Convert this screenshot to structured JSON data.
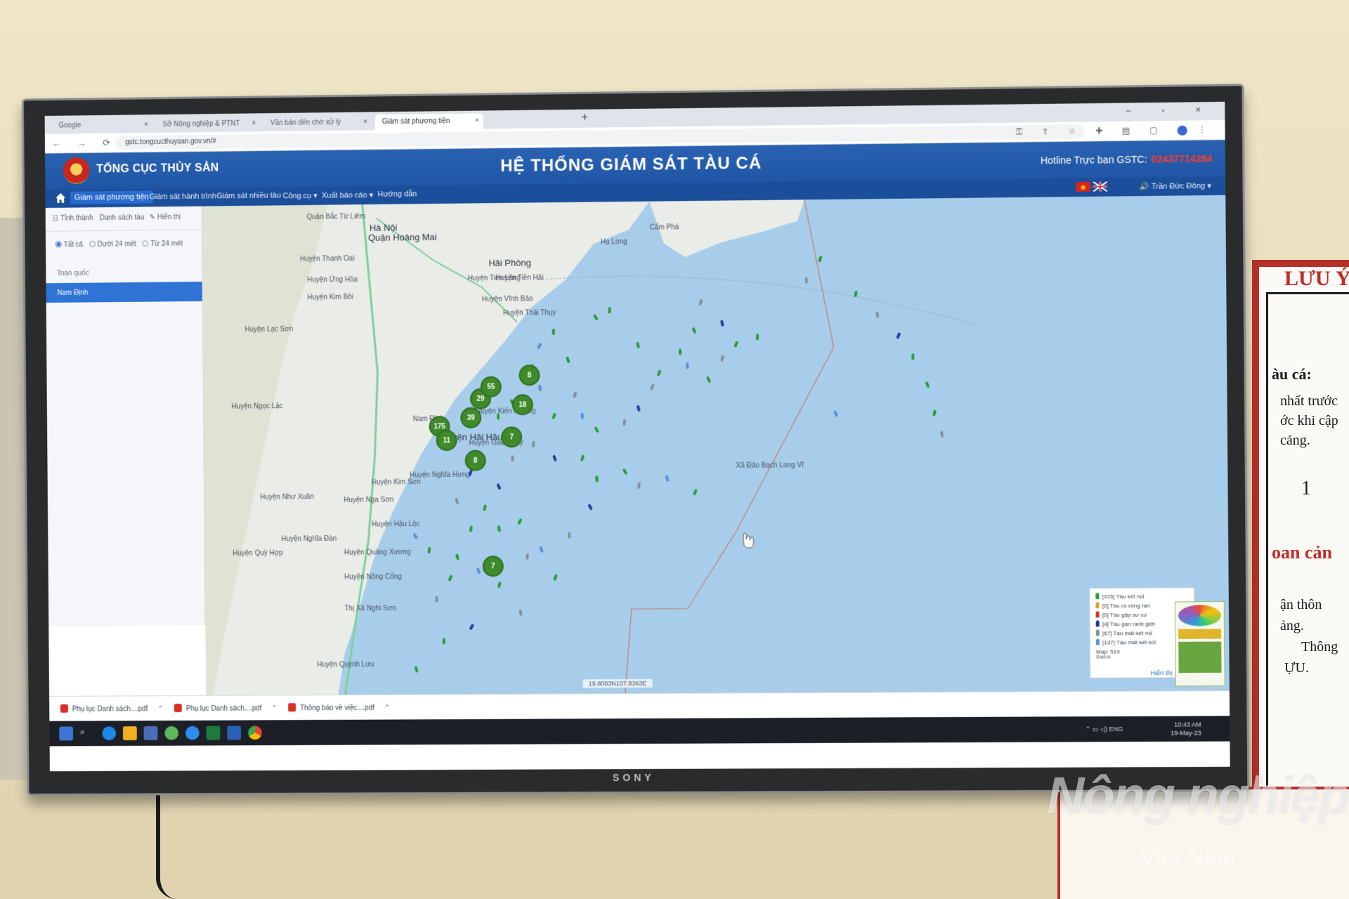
{
  "browser": {
    "tabs": [
      {
        "label": "Google"
      },
      {
        "label": "Sở Nông nghiệp & PTNT"
      },
      {
        "label": "Văn bản đến chờ xử lý"
      },
      {
        "label": "Giám sát phương tiện"
      }
    ],
    "url": "gstc.tongcucthuysan.gov.vn/#"
  },
  "header": {
    "agency": "TỔNG CỤC THỦY SẢN",
    "title": "HỆ THỐNG GIÁM SÁT TÀU CÁ",
    "hotline_label": "Hotline Trực ban GSTC:",
    "hotline_number": "02437714284"
  },
  "menu": {
    "items": [
      "Giám sát phương tiện",
      "Giám sát hành trình",
      "Giám sát nhiều tàu",
      "Công cụ ▾",
      "Xuất báo cáo ▾",
      "Hướng dẫn"
    ],
    "user": "Trần Đức Đông ▾"
  },
  "sidebar": {
    "tabs": [
      "Tỉnh thành",
      "Danh sách tàu",
      "Hiển thị"
    ],
    "filters": [
      "Tất cả",
      "Dưới 24 mét",
      "Từ 24 mét"
    ],
    "items": [
      "Toàn quốc",
      "Nam Định"
    ]
  },
  "map": {
    "places": [
      "Hà Nội",
      "Quận Hoàng Mai",
      "Hải Phòng",
      "Huyện Hải Hậu",
      "Nam Định",
      "Huyện Giao Thủy",
      "Huyện Nghĩa Hưng",
      "Huyện Kim Sơn",
      "Huyện Nga Sơn",
      "Huyện Hậu Lộc",
      "Huyện Quảng Xương",
      "Huyện Nông Cống",
      "Thị Xã Nghi Sơn",
      "Huyện Quỳnh Lưu",
      "Cẩm Phả",
      "Hạ Long",
      "Xã Đảo Bạch Long Vĩ",
      "Huyện Thái Thụy",
      "Huyện Tiền Hải",
      "Huyện Kiến Xương",
      "Huyện Vĩnh Bảo",
      "Huyện Tiên Lãng",
      "Quận Bắc Từ Liêm",
      "Huyện Thanh Oai",
      "Huyện Ứng Hòa",
      "Huyện Kim Bôi",
      "Huyện Lạc Sơn",
      "Huyện Ngọc Lặc",
      "Huyện Như Xuân",
      "Huyện Quỳ Hợp",
      "Huyện Nghĩa Đàn"
    ],
    "clusters": [
      {
        "count": "175"
      },
      {
        "count": "11"
      },
      {
        "count": "39"
      },
      {
        "count": "29"
      },
      {
        "count": "55"
      },
      {
        "count": "8"
      },
      {
        "count": "18"
      },
      {
        "count": "7"
      },
      {
        "count": "8"
      },
      {
        "count": "7"
      }
    ],
    "cursor_coords": "19.8003N107.8363E"
  },
  "legend": {
    "rows": [
      {
        "text": "[315] Tàu kết nối",
        "color": "#2e9a3a"
      },
      {
        "text": "[0] Tàu ra vùng rạn",
        "color": "#e0a22b"
      },
      {
        "text": "[0] Tàu gặp sự cố",
        "color": "#d93025"
      },
      {
        "text": "[4] Tàu gần ranh giới",
        "color": "#1f3f9a"
      },
      {
        "text": "[67] Tàu mất kết nối",
        "color": "#8a8f99"
      },
      {
        "text": "[137] Tàu mất kết nối",
        "color": "#5a8fd8"
      }
    ],
    "total": "Map: 519",
    "base": "Basics",
    "show_button": "Hiển thị"
  },
  "downloads": [
    {
      "name": "Phụ lục Danh sách....pdf"
    },
    {
      "name": "Phụ lục Danh sách....pdf"
    },
    {
      "name": "Thông báo về việc....pdf"
    }
  ],
  "taskbar": {
    "lang": "ENG",
    "time": "10:43 AM",
    "date": "19-May-23"
  },
  "tv": {
    "brand": "SONY"
  },
  "poster": {
    "heading": "LƯU Ý",
    "lines": [
      "àu cá:",
      "nhất trước",
      "ớc khi cập",
      "cảng.",
      "1",
      "oan cản",
      "ận thôn",
      "ảng.",
      "Thông",
      "ỰU."
    ]
  },
  "watermark": {
    "line1": "Nông nghiệp",
    "line2": "Việt Nam"
  }
}
